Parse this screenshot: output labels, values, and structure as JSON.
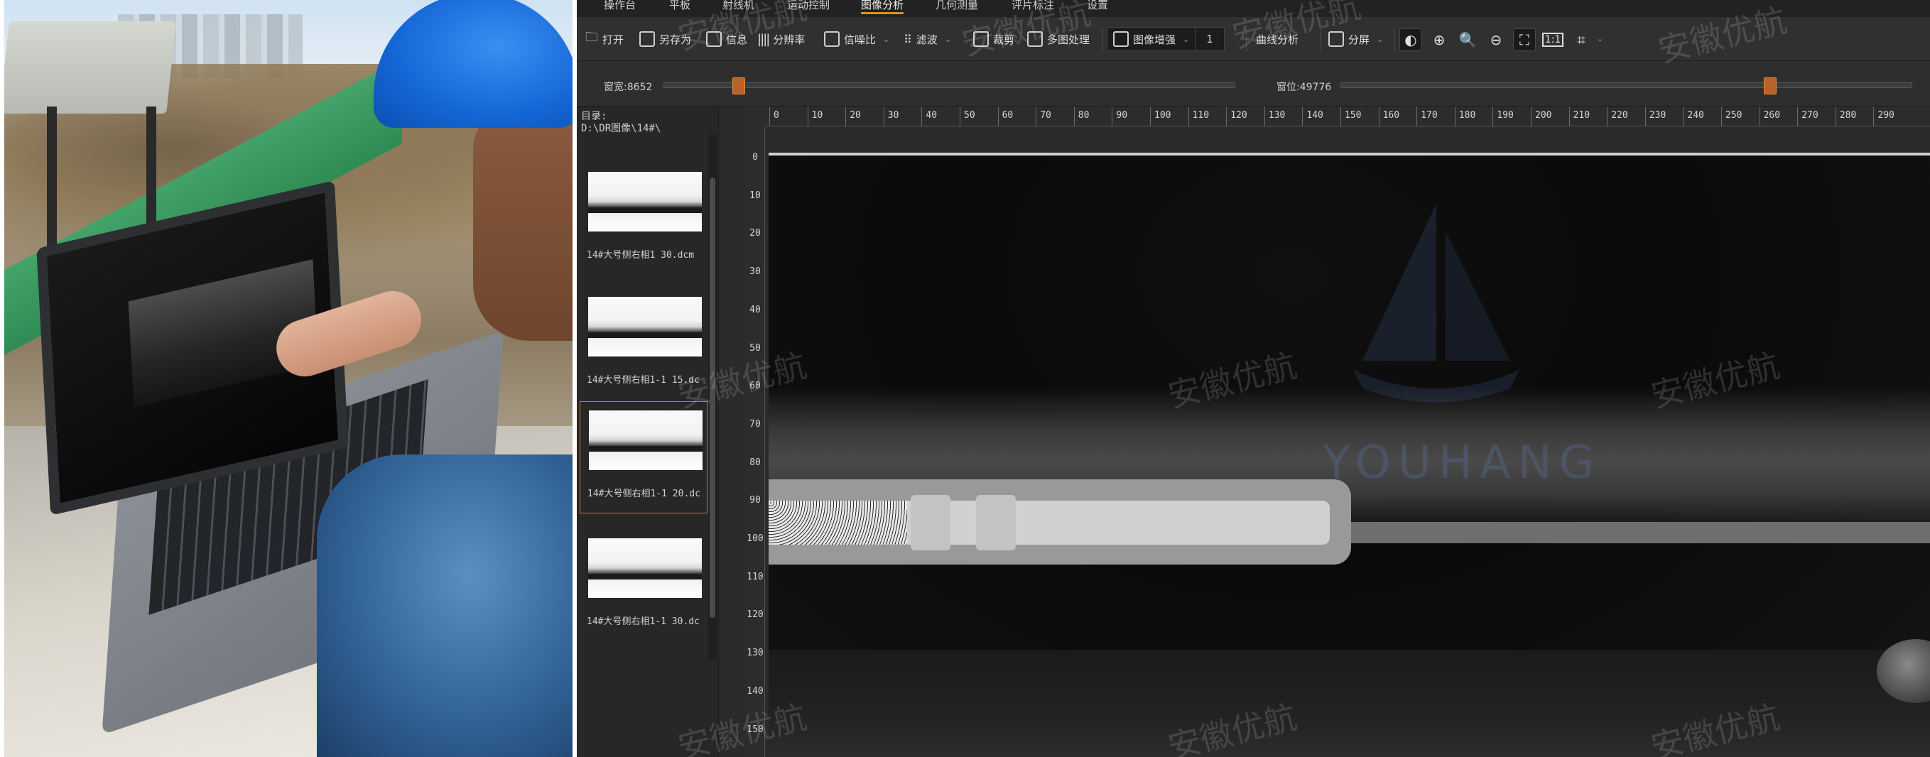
{
  "menu": [
    "操作台",
    "平板",
    "射线机",
    "运动控制",
    "图像分析",
    "几何测量",
    "评片标注",
    "设置"
  ],
  "menu_active_index": 4,
  "toolbar": {
    "open": "打开",
    "save_as": "另存为",
    "info": "信息",
    "resolution": "分辨率",
    "snr": "信噪比",
    "filter": "滤波",
    "crop": "裁剪",
    "multi": "多图处理",
    "enhance": "图像增强",
    "enhance_value": "1",
    "curve": "曲线分析",
    "split": "分屏"
  },
  "sliders": {
    "window_width_label": "窗宽:8652",
    "window_level_label": "窗位:49776",
    "window_width_fraction": 0.13,
    "window_level_fraction": 0.75
  },
  "sidebar": {
    "dir_title": "目录:",
    "dir_path": "D:\\DR图像\\14#\\",
    "thumbs": [
      {
        "caption": "14#大号侧右相1  30.dcm"
      },
      {
        "caption": "14#大号侧右相1-1  15.dc"
      },
      {
        "caption": "14#大号侧右相1-1  20.dc"
      },
      {
        "caption": "14#大号侧右相1-1  30.dc"
      }
    ],
    "selected_index": 2
  },
  "ruler": {
    "top": [
      "0",
      "10",
      "20",
      "30",
      "40",
      "50",
      "60",
      "70",
      "80",
      "90",
      "100",
      "110",
      "120",
      "130",
      "140",
      "150",
      "160",
      "170",
      "180",
      "190",
      "200",
      "210",
      "220",
      "230",
      "240",
      "250",
      "260",
      "270",
      "280",
      "290"
    ],
    "left": [
      "0",
      "10",
      "20",
      "30",
      "40",
      "50",
      "60",
      "70",
      "80",
      "90",
      "100",
      "110",
      "120",
      "130",
      "140",
      "150"
    ]
  },
  "watermark": "安徽优航",
  "logo_text": "YOUHANG"
}
